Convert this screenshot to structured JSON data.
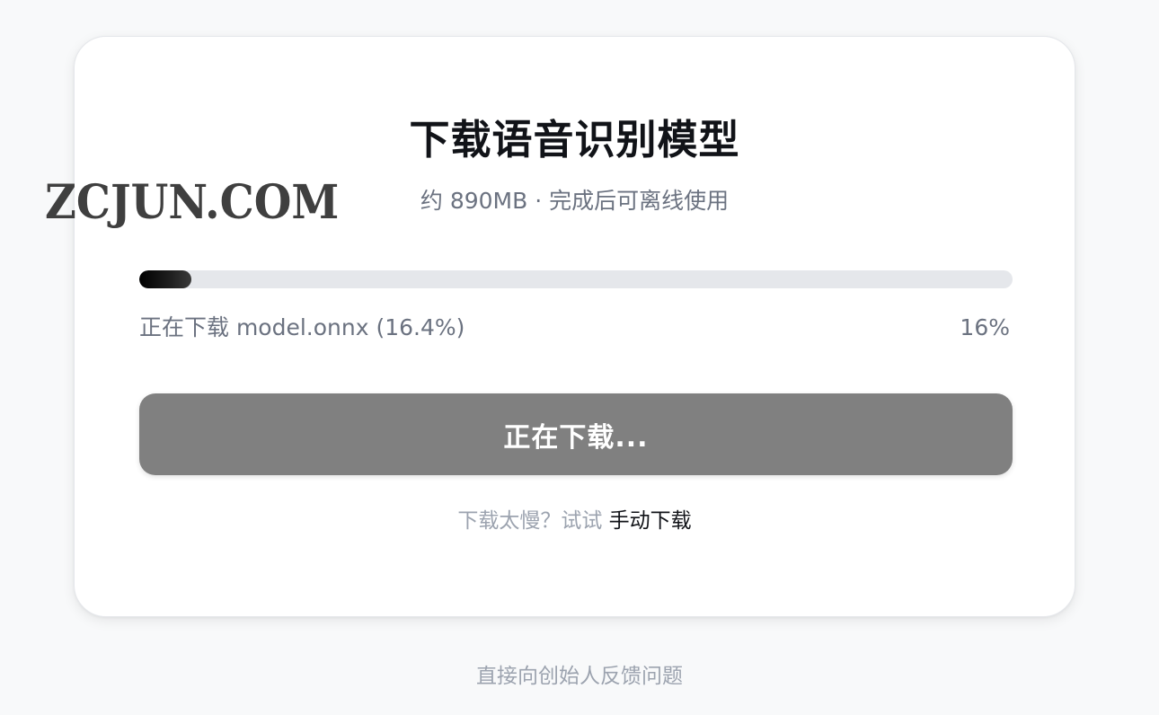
{
  "dialog": {
    "title": "下载语音识别模型",
    "subtitle": "约 890MB · 完成后可离线使用",
    "progress": {
      "percent": 16.4,
      "status_text": "正在下载 model.onnx (16.4%)",
      "percent_label": "16%"
    },
    "download_button_label": "正在下载...",
    "hint_prefix": "下载太慢？试试 ",
    "hint_link": "手动下载"
  },
  "watermark_text": "ZCJUN.COM",
  "footer_link": "直接向创始人反馈问题",
  "colors": {
    "background": "#f8f9fa",
    "card": "#ffffff",
    "progress_track": "#e5e7eb",
    "progress_fill": "#000000",
    "button_disabled": "#808080",
    "muted_text": "#6b7280",
    "title_text": "#111318"
  }
}
